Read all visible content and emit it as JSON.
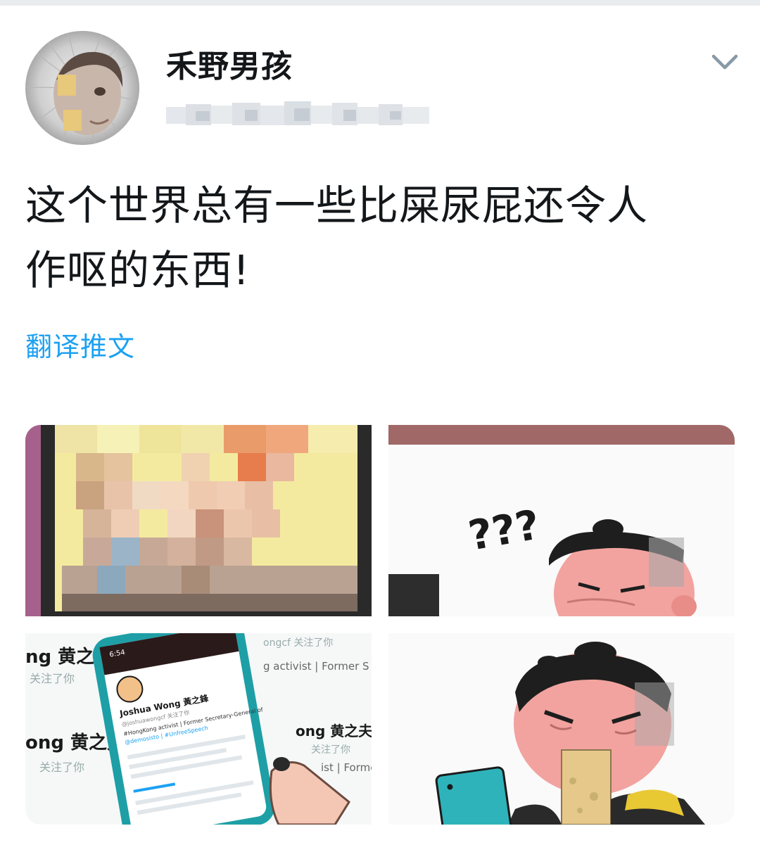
{
  "author": {
    "display_name": "禾野男孩"
  },
  "tweet": {
    "text_line1": "这个世界总有一些比屎尿屁还令人",
    "text_line2": "作呕的东西!",
    "translate_label": "翻译推文"
  },
  "media": {
    "third": {
      "name_left_top": "ng 黄之",
      "follow_left_top": "关注了你",
      "profile_name": "Joshua Wong 黃之鋒",
      "profile_handle": "@joshuawongcf 关注了你",
      "profile_bio1": "#HongKong activist | Former Secretary-General of",
      "profile_bio2": "@demosisto | #UnfreeSpeech",
      "name_left_mid": "ong 黄之夫",
      "follow_left_mid": "关注了你",
      "text_right_top": "ongcf 关注了你",
      "text_right_mid": "g activist | Former S",
      "name_right_low": "ong 黄之夫",
      "follow_right_low": "关注了你",
      "text_right_bot": "ist | Forme",
      "time": "6:54"
    },
    "second": {
      "question_marks": "???"
    }
  },
  "colors": {
    "link": "#1da1f2",
    "text": "#14171a",
    "chevron": "#8899a6"
  }
}
